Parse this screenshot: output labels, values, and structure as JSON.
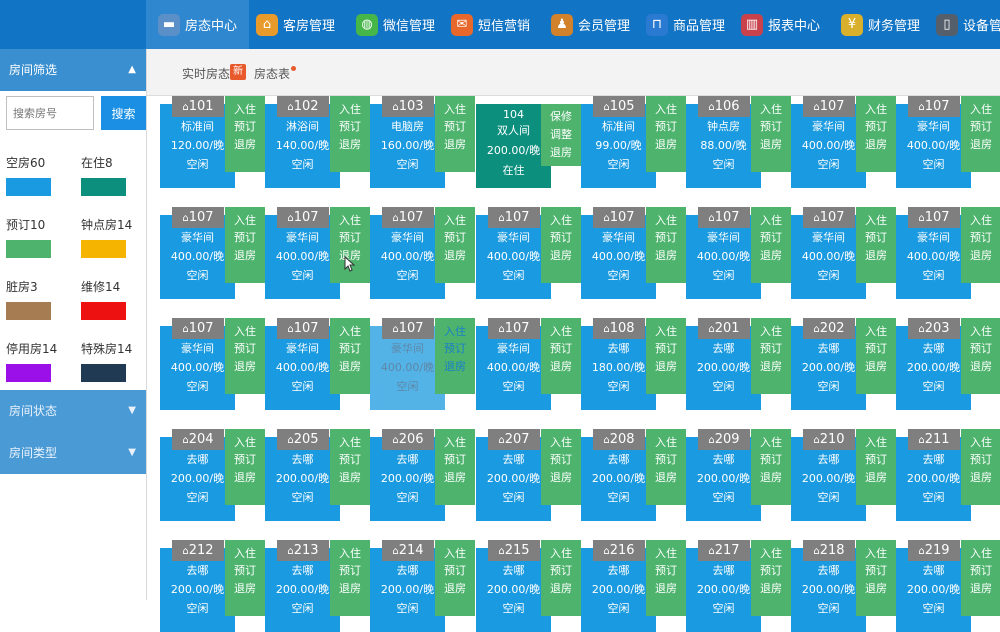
{
  "nav": [
    {
      "label": "房态中心",
      "icon": "bed-icon",
      "color": "#5b8fc7",
      "active": true
    },
    {
      "label": "客房管理",
      "icon": "house-icon",
      "color": "#e89a2b"
    },
    {
      "label": "微信管理",
      "icon": "wechat-icon",
      "color": "#46b649"
    },
    {
      "label": "短信营销",
      "icon": "message-icon",
      "color": "#e8682b"
    },
    {
      "label": "会员管理",
      "icon": "member-icon",
      "color": "#d1822a"
    },
    {
      "label": "商品管理",
      "icon": "cart-icon",
      "color": "#2b7ad1"
    },
    {
      "label": "报表中心",
      "icon": "chart-icon",
      "color": "#c9424b"
    },
    {
      "label": "财务管理",
      "icon": "money-icon",
      "color": "#d8b02b"
    },
    {
      "label": "设备管理",
      "icon": "device-icon",
      "color": "#555f6b"
    }
  ],
  "subbar": {
    "realtime": "实时房态",
    "badge": "新",
    "room_table": "房态表"
  },
  "sidebar": {
    "filter_title": "房间筛选",
    "search_placeholder": "搜索房号",
    "search_button": "搜索",
    "legend": [
      {
        "label": "空房60",
        "color": "#1a9ae0"
      },
      {
        "label": "在住8",
        "color": "#0d8f7e"
      },
      {
        "label": "预订10",
        "color": "#4db36d"
      },
      {
        "label": "钟点房14",
        "color": "#f5b400"
      },
      {
        "label": "脏房3",
        "color": "#a67c52"
      },
      {
        "label": "维修14",
        "color": "#ee1111"
      },
      {
        "label": "停用房14",
        "color": "#9b0fe8"
      },
      {
        "label": "特殊房14",
        "color": "#1f3a52"
      }
    ],
    "status_title": "房间状态",
    "type_title": "房间类型"
  },
  "actions": {
    "checkin": "入住",
    "reserve": "预订",
    "checkout": "退房"
  },
  "maint_actions": [
    "保修",
    "调整",
    "退房"
  ],
  "rooms": [
    [
      {
        "num": "101",
        "type": "标准间",
        "price": "120.00/晚",
        "status": "空闲"
      },
      {
        "num": "102",
        "type": "淋浴间",
        "price": "140.00/晚",
        "status": "空闲"
      },
      {
        "num": "103",
        "type": "电脑房",
        "price": "160.00/晚",
        "status": "空闲"
      },
      {
        "num": "104",
        "type": "双人间",
        "price": "200.00/晚",
        "status": "在住",
        "occupied": true
      },
      {
        "num": "105",
        "type": "标准间",
        "price": "99.00/晚",
        "status": "空闲"
      },
      {
        "num": "106",
        "type": "钟点房",
        "price": "88.00/晚",
        "status": "空闲"
      },
      {
        "num": "107",
        "type": "豪华间",
        "price": "400.00/晚",
        "status": "空闲"
      },
      {
        "num": "107",
        "type": "豪华间",
        "price": "400.00/晚",
        "status": "空闲"
      }
    ],
    [
      {
        "num": "107",
        "type": "豪华间",
        "price": "400.00/晚",
        "status": "空闲"
      },
      {
        "num": "107",
        "type": "豪华间",
        "price": "400.00/晚",
        "status": "空闲"
      },
      {
        "num": "107",
        "type": "豪华间",
        "price": "400.00/晚",
        "status": "空闲"
      },
      {
        "num": "107",
        "type": "豪华间",
        "price": "400.00/晚",
        "status": "空闲"
      },
      {
        "num": "107",
        "type": "豪华间",
        "price": "400.00/晚",
        "status": "空闲"
      },
      {
        "num": "107",
        "type": "豪华间",
        "price": "400.00/晚",
        "status": "空闲"
      },
      {
        "num": "107",
        "type": "豪华间",
        "price": "400.00/晚",
        "status": "空闲"
      },
      {
        "num": "107",
        "type": "豪华间",
        "price": "400.00/晚",
        "status": "空闲"
      }
    ],
    [
      {
        "num": "107",
        "type": "豪华间",
        "price": "400.00/晚",
        "status": "空闲"
      },
      {
        "num": "107",
        "type": "豪华间",
        "price": "400.00/晚",
        "status": "空闲"
      },
      {
        "num": "107",
        "type": "豪华间",
        "price": "400.00/晚",
        "status": "空闲",
        "dim": true
      },
      {
        "num": "107",
        "type": "豪华间",
        "price": "400.00/晚",
        "status": "空闲"
      },
      {
        "num": "108",
        "type": "去哪",
        "price": "180.00/晚",
        "status": "空闲"
      },
      {
        "num": "201",
        "type": "去哪",
        "price": "200.00/晚",
        "status": "空闲"
      },
      {
        "num": "202",
        "type": "去哪",
        "price": "200.00/晚",
        "status": "空闲"
      },
      {
        "num": "203",
        "type": "去哪",
        "price": "200.00/晚",
        "status": "空闲"
      }
    ],
    [
      {
        "num": "204",
        "type": "去哪",
        "price": "200.00/晚",
        "status": "空闲"
      },
      {
        "num": "205",
        "type": "去哪",
        "price": "200.00/晚",
        "status": "空闲"
      },
      {
        "num": "206",
        "type": "去哪",
        "price": "200.00/晚",
        "status": "空闲"
      },
      {
        "num": "207",
        "type": "去哪",
        "price": "200.00/晚",
        "status": "空闲"
      },
      {
        "num": "208",
        "type": "去哪",
        "price": "200.00/晚",
        "status": "空闲"
      },
      {
        "num": "209",
        "type": "去哪",
        "price": "200.00/晚",
        "status": "空闲"
      },
      {
        "num": "210",
        "type": "去哪",
        "price": "200.00/晚",
        "status": "空闲"
      },
      {
        "num": "211",
        "type": "去哪",
        "price": "200.00/晚",
        "status": "空闲"
      }
    ],
    [
      {
        "num": "212",
        "type": "去哪",
        "price": "200.00/晚",
        "status": "空闲"
      },
      {
        "num": "213",
        "type": "去哪",
        "price": "200.00/晚",
        "status": "空闲"
      },
      {
        "num": "214",
        "type": "去哪",
        "price": "200.00/晚",
        "status": "空闲"
      },
      {
        "num": "215",
        "type": "去哪",
        "price": "200.00/晚",
        "status": "空闲"
      },
      {
        "num": "216",
        "type": "去哪",
        "price": "200.00/晚",
        "status": "空闲"
      },
      {
        "num": "217",
        "type": "去哪",
        "price": "200.00/晚",
        "status": "空闲"
      },
      {
        "num": "218",
        "type": "去哪",
        "price": "200.00/晚",
        "status": "空闲"
      },
      {
        "num": "219",
        "type": "去哪",
        "price": "200.00/晚",
        "status": "空闲"
      }
    ]
  ]
}
